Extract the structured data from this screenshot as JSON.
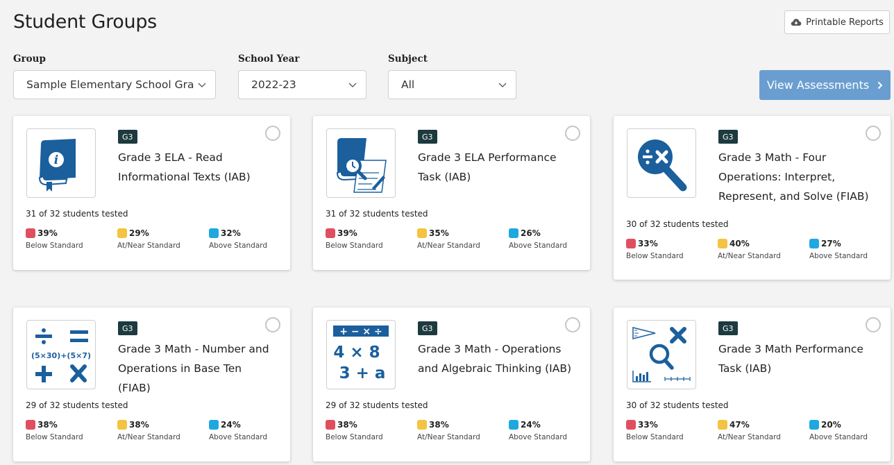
{
  "page": {
    "title": "Student Groups",
    "printable_reports": "Printable Reports"
  },
  "filters": {
    "group": {
      "label": "Group",
      "value": "Sample Elementary School Gra"
    },
    "school_year": {
      "label": "School Year",
      "value": "2022-23"
    },
    "subject": {
      "label": "Subject",
      "value": "All"
    }
  },
  "view_assessments": "View Assessments",
  "colors": {
    "below": "#e04f5f",
    "near": "#f5c342",
    "above": "#1fa8e0",
    "badge": "#1d3a3f",
    "button": "#6a9ed0"
  },
  "cards": [
    {
      "badge": "G3",
      "title": "Grade 3 ELA - Read Informational Texts (IAB)",
      "tested": "31 of 32 students tested",
      "icon": "book-info-icon",
      "stats": [
        {
          "pct": "39%",
          "label": "Below Standard"
        },
        {
          "pct": "29%",
          "label": "At/Near Standard"
        },
        {
          "pct": "32%",
          "label": "Above Standard"
        }
      ]
    },
    {
      "badge": "G3",
      "title": "Grade 3 ELA Performance Task (IAB)",
      "tested": "31 of 32 students tested",
      "icon": "book-magnifier-icon",
      "stats": [
        {
          "pct": "39%",
          "label": "Below Standard"
        },
        {
          "pct": "35%",
          "label": "At/Near Standard"
        },
        {
          "pct": "26%",
          "label": "Above Standard"
        }
      ]
    },
    {
      "badge": "G3",
      "title": "Grade 3 Math - Four Operations: Interpret, Represent, and Solve (FIAB)",
      "tested": "30 of 32 students tested",
      "icon": "magnifier-operations-icon",
      "stats": [
        {
          "pct": "33%",
          "label": "Below Standard"
        },
        {
          "pct": "40%",
          "label": "At/Near Standard"
        },
        {
          "pct": "27%",
          "label": "Above Standard"
        }
      ]
    },
    {
      "badge": "G3",
      "title": "Grade 3 Math - Number and Operations in Base Ten (FIAB)",
      "tested": "29 of 32 students tested",
      "icon": "math-symbols-icon",
      "icon_text": "(5×30)+(5×7)",
      "stats": [
        {
          "pct": "38%",
          "label": "Below Standard"
        },
        {
          "pct": "38%",
          "label": "At/Near Standard"
        },
        {
          "pct": "24%",
          "label": "Above Standard"
        }
      ]
    },
    {
      "badge": "G3",
      "title": "Grade 3 Math - Operations and Algebraic Thinking (IAB)",
      "tested": "29 of 32 students tested",
      "icon": "algebra-icon",
      "icon_ops": "+ − × ÷",
      "icon_line1": "4 × 8",
      "icon_line2": "3 + a",
      "stats": [
        {
          "pct": "38%",
          "label": "Below Standard"
        },
        {
          "pct": "38%",
          "label": "At/Near Standard"
        },
        {
          "pct": "24%",
          "label": "Above Standard"
        }
      ]
    },
    {
      "badge": "G3",
      "title": "Grade 3 Math Performance Task (IAB)",
      "tested": "30 of 32 students tested",
      "icon": "math-performance-icon",
      "stats": [
        {
          "pct": "33%",
          "label": "Below Standard"
        },
        {
          "pct": "47%",
          "label": "At/Near Standard"
        },
        {
          "pct": "20%",
          "label": "Above Standard"
        }
      ]
    }
  ]
}
